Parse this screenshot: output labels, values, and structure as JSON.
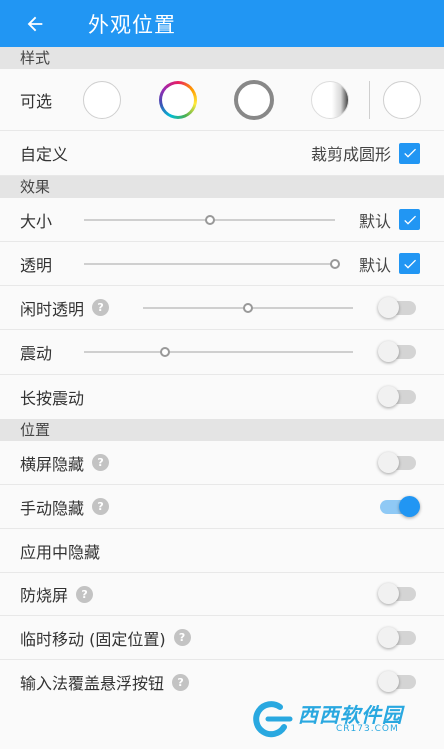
{
  "appbar": {
    "title": "外观位置"
  },
  "colors": {
    "accent": "#2196f3",
    "header_bg": "#e4e4e4",
    "switch_off": "#d4d4d4"
  },
  "sections": {
    "style": "样式",
    "effect": "效果",
    "position": "位置"
  },
  "style_row": {
    "label": "可选"
  },
  "custom_row": {
    "label": "自定义",
    "crop_label": "裁剪成圆形",
    "crop_checked": true
  },
  "size_row": {
    "label": "大小",
    "default_label": "默认",
    "default_checked": true,
    "slider_value": 0.5
  },
  "opacity_row": {
    "label": "透明",
    "default_label": "默认",
    "default_checked": true,
    "slider_value": 1.0
  },
  "idle_row": {
    "label": "闲时透明",
    "has_help": true,
    "slider_value": 0.5,
    "enabled": false
  },
  "vibrate_row": {
    "label": "震动",
    "slider_value": 0.3,
    "enabled": false
  },
  "longpress_row": {
    "label": "长按震动",
    "enabled": false
  },
  "landscape_row": {
    "label": "横屏隐藏",
    "has_help": true,
    "enabled": false
  },
  "manual_row": {
    "label": "手动隐藏",
    "has_help": true,
    "enabled": true
  },
  "apphide_row": {
    "label": "应用中隐藏"
  },
  "burnin_row": {
    "label": "防烧屏",
    "has_help": true,
    "enabled": false
  },
  "tempmove_row": {
    "label": "临时移动 (固定位置)",
    "has_help": true,
    "enabled": false
  },
  "ime_row": {
    "label": "输入法覆盖悬浮按钮",
    "has_help": true,
    "enabled": false
  },
  "watermark": {
    "text": "西西软件园",
    "sub": "CR173.COM"
  },
  "help_glyph": "?",
  "icons": {
    "back": "arrow-back-icon",
    "check": "check-icon",
    "help": "help-icon"
  }
}
